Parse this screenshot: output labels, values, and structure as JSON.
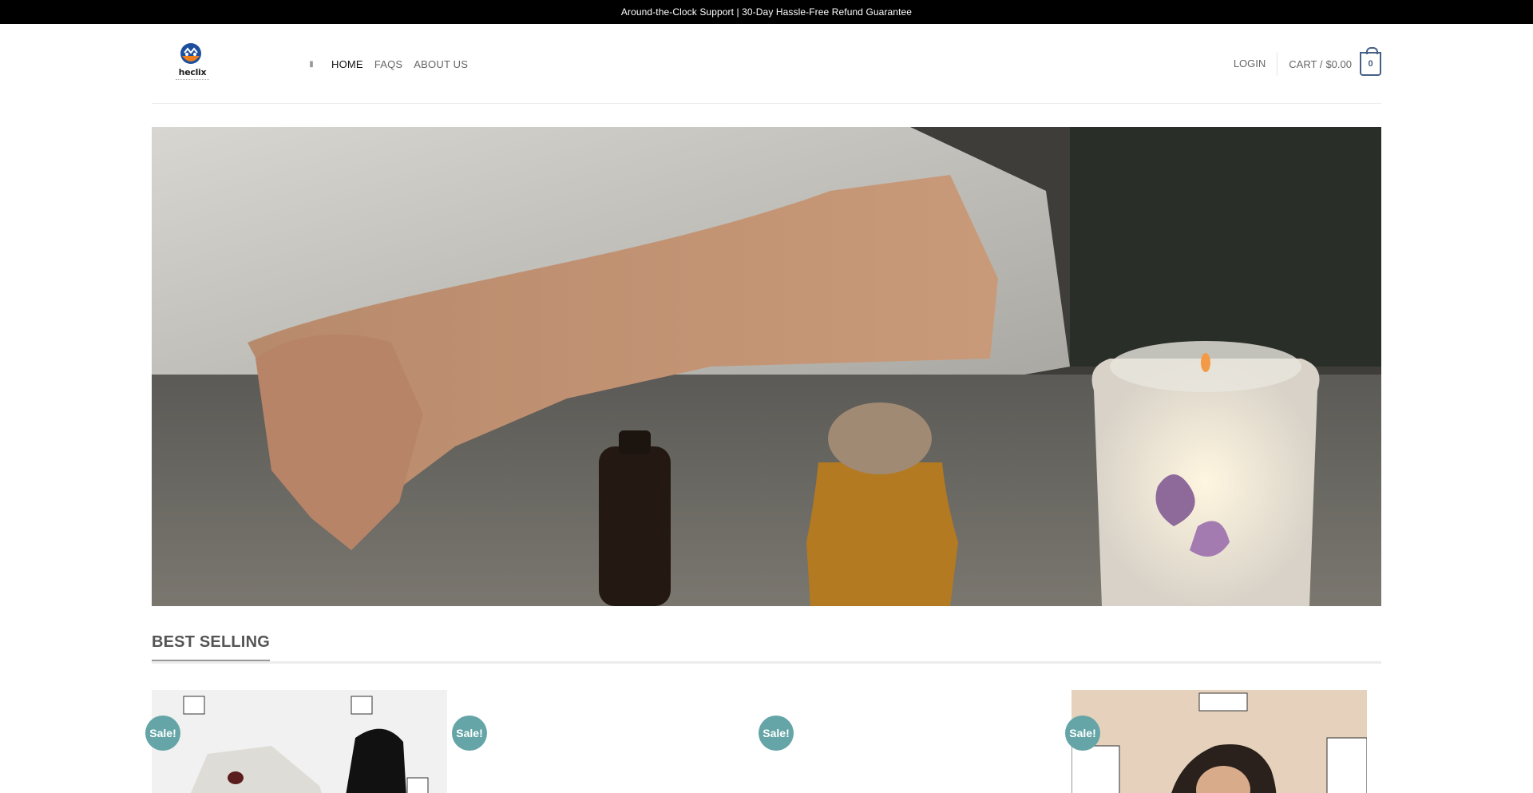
{
  "topbar": {
    "text": "Around-the-Clock Support | 30-Day Hassle-Free Refund Guarantee"
  },
  "logo": {
    "text": "heclix",
    "icon": "logo-badge-icon"
  },
  "nav": {
    "menu_icon": "menu-icon",
    "items": [
      {
        "label": "HOME",
        "active": true
      },
      {
        "label": "FAQS",
        "active": false
      },
      {
        "label": "ABOUT US",
        "active": false
      }
    ]
  },
  "account": {
    "login_label": "LOGIN"
  },
  "cart": {
    "label": "CART /",
    "amount": "$0.00",
    "count": "0"
  },
  "section": {
    "title": "BEST SELLING"
  },
  "products": [
    {
      "badge": "Sale!"
    },
    {
      "badge": "Sale!"
    },
    {
      "badge": "Sale!"
    },
    {
      "badge": "Sale!"
    }
  ],
  "colors": {
    "accent": "#446084",
    "sale_badge": "#65a5a7",
    "topbar_bg": "#000000"
  }
}
